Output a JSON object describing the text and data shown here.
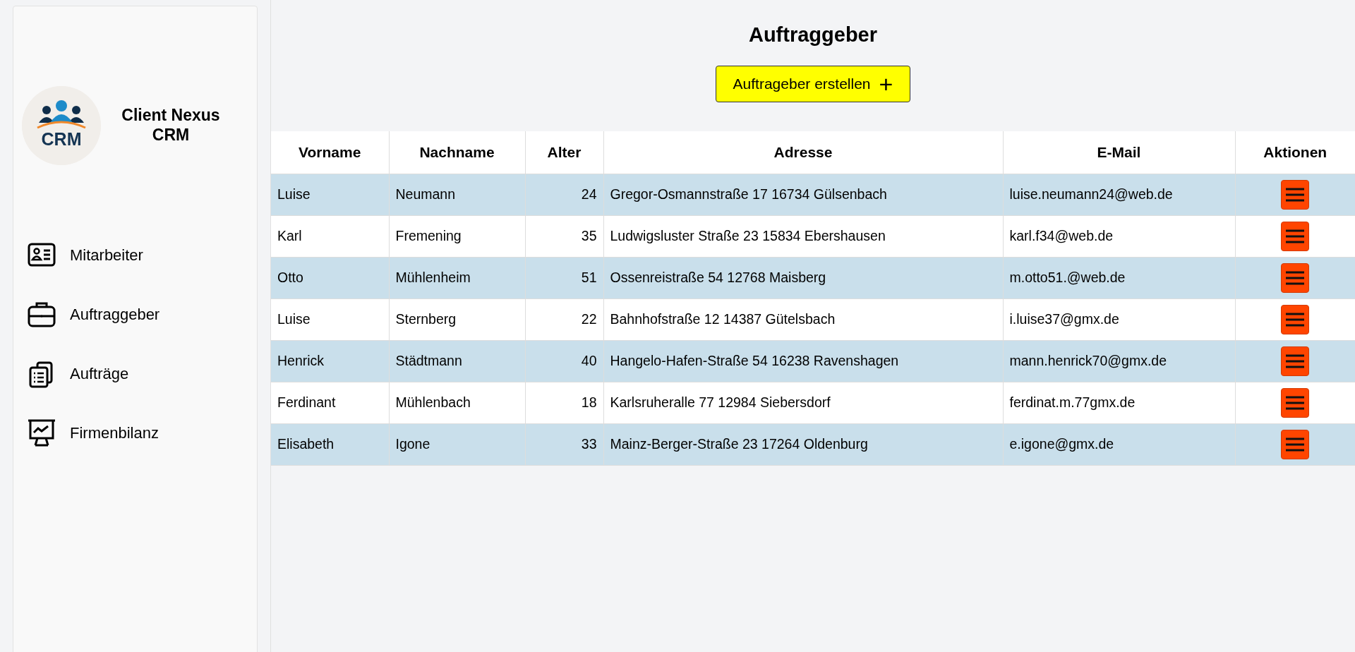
{
  "brand": {
    "name": "Client Nexus CRM",
    "logo_text": "CRM"
  },
  "sidebar": {
    "items": [
      {
        "label": "Mitarbeiter"
      },
      {
        "label": "Auftraggeber"
      },
      {
        "label": "Aufträge"
      },
      {
        "label": "Firmenbilanz"
      }
    ]
  },
  "page_title": "Auftraggeber",
  "create_button": {
    "label": "Auftrageber erstellen",
    "icon": "+"
  },
  "table": {
    "columns": [
      "Vorname",
      "Nachname",
      "Alter",
      "Adresse",
      "E-Mail",
      "Aktionen"
    ],
    "rows": [
      {
        "vorname": "Luise",
        "nachname": "Neumann",
        "alter": "24",
        "adresse": "Gregor-Osmannstraße 17 16734 Gülsenbach",
        "email": "luise.neumann24@web.de"
      },
      {
        "vorname": "Karl",
        "nachname": "Fremening",
        "alter": "35",
        "adresse": "Ludwigsluster Straße 23 15834 Ebershausen",
        "email": "karl.f34@web.de"
      },
      {
        "vorname": "Otto",
        "nachname": "Mühlenheim",
        "alter": "51",
        "adresse": "Ossenreistraße 54 12768 Maisberg",
        "email": "m.otto51.@web.de"
      },
      {
        "vorname": "Luise",
        "nachname": "Sternberg",
        "alter": "22",
        "adresse": "Bahnhofstraße 12 14387 Gütelsbach",
        "email": "i.luise37@gmx.de"
      },
      {
        "vorname": "Henrick",
        "nachname": "Städtmann",
        "alter": "40",
        "adresse": "Hangelo-Hafen-Straße 54 16238 Ravenshagen",
        "email": "mann.henrick70@gmx.de"
      },
      {
        "vorname": "Ferdinant",
        "nachname": "Mühlenbach",
        "alter": "18",
        "adresse": "Karlsruheralle 77 12984 Siebersdorf",
        "email": "ferdinat.m.77gmx.de"
      },
      {
        "vorname": "Elisabeth",
        "nachname": "Igone",
        "alter": "33",
        "adresse": "Mainz-Berger-Straße 23 17264 Oldenburg",
        "email": "e.igone@gmx.de"
      }
    ]
  }
}
